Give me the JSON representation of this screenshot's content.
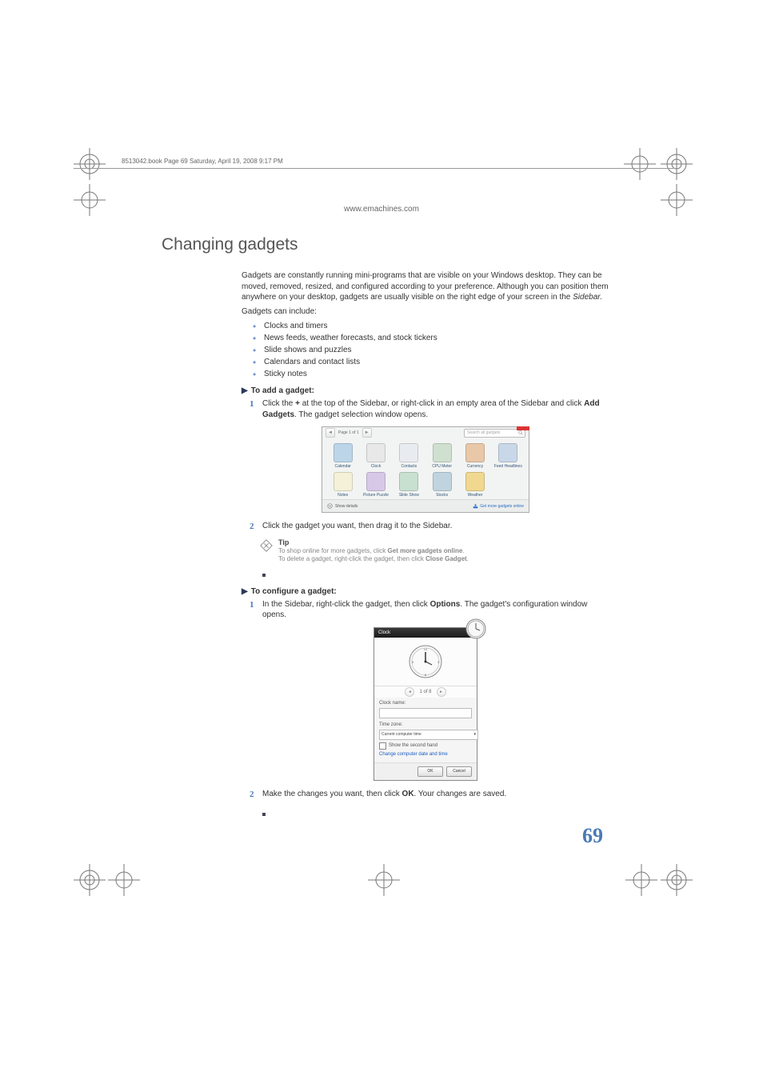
{
  "header": {
    "slug": "8513042.book  Page 69  Saturday, April 19, 2008  9:17 PM",
    "url": "www.emachines.com"
  },
  "title": "Changing gadgets",
  "intro": {
    "p1": "Gadgets are constantly running mini-programs that are visible on your Windows desktop. They can be moved, removed, resized, and configured according to your preference. Although you can position them anywhere on your desktop, gadgets are usually visible on the right edge of your screen in the ",
    "p1_em": "Sidebar.",
    "p2": "Gadgets can include:"
  },
  "bullets": [
    "Clocks and timers",
    "News feeds, weather forecasts, and stock tickers",
    "Slide shows and puzzles",
    "Calendars and contact lists",
    "Sticky notes"
  ],
  "proc1": {
    "heading": "To add a gadget:",
    "step1_a": "Click the ",
    "step1_b": "+",
    "step1_c": " at the top of the Sidebar, or right-click in an empty area of the Sidebar and click ",
    "step1_d": "Add Gadgets",
    "step1_e": ". The gadget selection window opens.",
    "step2": "Click the gadget you want, then drag it to the Sidebar."
  },
  "gadget_window": {
    "page_label": "Page 1 of 1",
    "search_placeholder": "Search all gadgets",
    "items": [
      {
        "label": "Calendar",
        "color": "#bcd5e8"
      },
      {
        "label": "Clock",
        "color": "#e8e8e8"
      },
      {
        "label": "Contacts",
        "color": "#e8ecf0"
      },
      {
        "label": "CPU Meter",
        "color": "#d0e0d0"
      },
      {
        "label": "Currency",
        "color": "#e8c8a8"
      },
      {
        "label": "Feed Headlines",
        "color": "#c8d8e8"
      },
      {
        "label": "Notes",
        "color": "#f5f0d8"
      },
      {
        "label": "Picture Puzzle",
        "color": "#d8c8e8"
      },
      {
        "label": "Slide Show",
        "color": "#c8e0d0"
      },
      {
        "label": "Stocks",
        "color": "#c0d4e0"
      },
      {
        "label": "Weather",
        "color": "#f0d890"
      }
    ],
    "show_details": "Show details",
    "get_more": "Get more gadgets online"
  },
  "tip": {
    "title": "Tip",
    "line1_a": "To shop online for more gadgets, click ",
    "line1_b": "Get more gadgets online",
    "line1_c": ".",
    "line2_a": "To delete a gadget, right-click the gadget, then click ",
    "line2_b": "Close Gadget",
    "line2_c": "."
  },
  "proc2": {
    "heading": "To configure a gadget:",
    "step1_a": "In the Sidebar, right-click the gadget, then click ",
    "step1_b": "Options",
    "step1_c": ". The gadget's configuration window opens.",
    "step2_a": "Make the changes you want, then click ",
    "step2_b": "OK",
    "step2_c": ". Your changes are saved."
  },
  "clock_window": {
    "title": "Clock",
    "nav": "1 of 8",
    "name_label": "Clock name:",
    "tz_label": "Time zone:",
    "tz_value": "Current computer time",
    "second_hand": "Show the second hand",
    "change_date": "Change computer date and time",
    "ok": "OK",
    "cancel": "Cancel"
  },
  "page_number": "69"
}
